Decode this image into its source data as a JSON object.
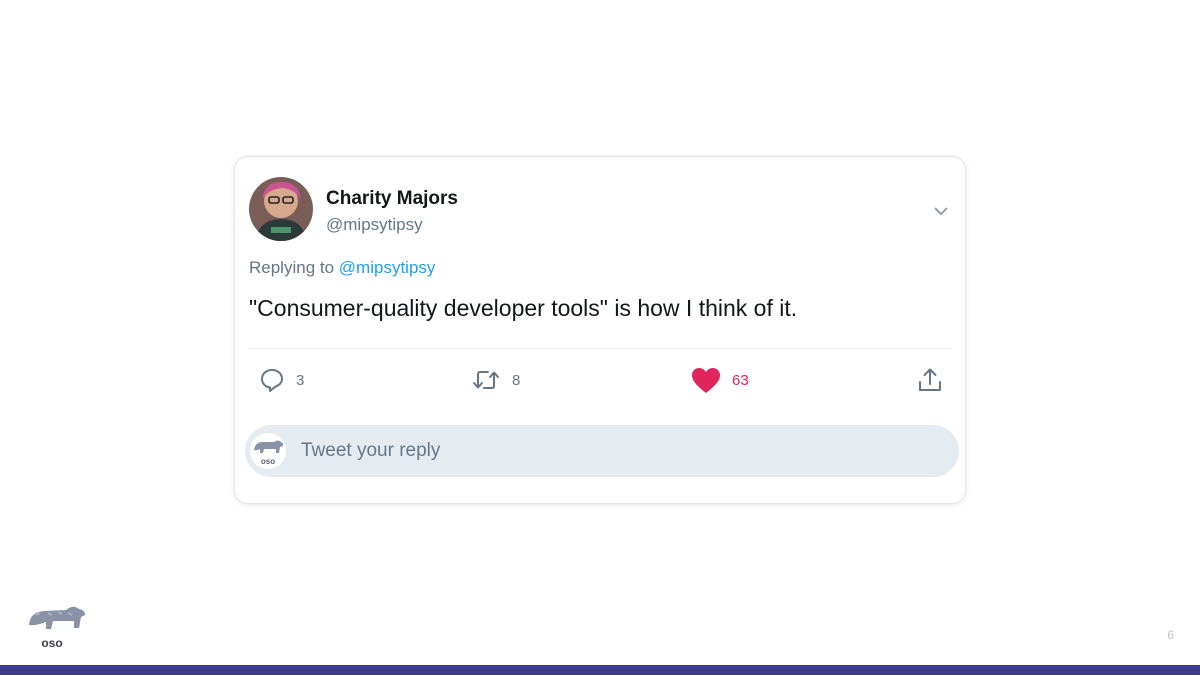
{
  "tweet": {
    "author_name": "Charity Majors",
    "author_handle": "@mipsytipsy",
    "replying_prefix": "Replying to",
    "replying_to": "@mipsytipsy",
    "text": "\"Consumer-quality developer tools\" is how I think of it.",
    "actions": {
      "reply_count": "3",
      "retweet_count": "8",
      "like_count": "63"
    },
    "reply_box": {
      "placeholder": "Tweet your reply",
      "avatar_logo_text": "oso"
    }
  },
  "footer": {
    "logo_text": "oso",
    "page_number": "6"
  },
  "colors": {
    "link": "#1da1f2",
    "like": "#e0245e",
    "muted": "#657786",
    "reply_box_bg": "#e4ebf1",
    "bottom_bar": "#3d3a8c"
  },
  "icons": {
    "more": "chevron-down-icon",
    "reply": "reply-icon",
    "retweet": "retweet-icon",
    "like": "heart-icon",
    "share": "share-icon"
  }
}
